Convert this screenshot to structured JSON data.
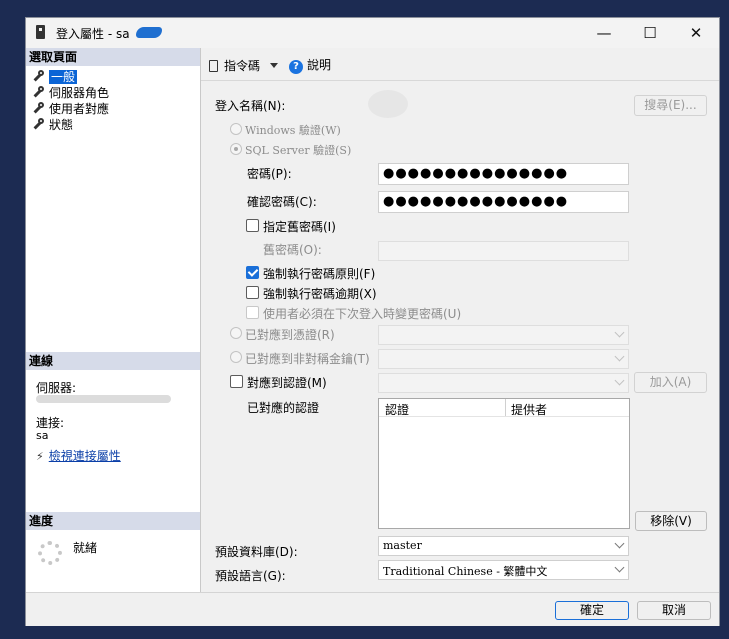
{
  "window": {
    "title": "登入屬性 - sa",
    "minimize": "—",
    "maximize": "☐",
    "close": "✕"
  },
  "left": {
    "select_page_header": "選取頁面",
    "pages": [
      {
        "label": "一般"
      },
      {
        "label": "伺服器角色"
      },
      {
        "label": "使用者對應"
      },
      {
        "label": "狀態"
      }
    ],
    "connection_header": "連線",
    "server_label": "伺服器:",
    "connection_label": "連接:",
    "connection_value": "sa",
    "view_conn_link": "檢視連接屬性",
    "progress_header": "進度",
    "progress_status": "就緒"
  },
  "toolbar": {
    "script_label": "指令碼",
    "help_label": "說明"
  },
  "form": {
    "login_name_label": "登入名稱(N):",
    "search_button": "搜尋(E)...",
    "windows_auth": "Windows 驗證(W)",
    "sql_auth": "SQL Server 驗證(S)",
    "password_label": "密碼(P):",
    "password_value": "●●●●●●●●●●●●●●●",
    "confirm_label": "確認密碼(C):",
    "confirm_value": "●●●●●●●●●●●●●●●",
    "specify_old_label": "指定舊密碼(I)",
    "old_password_label": "舊密碼(O):",
    "enforce_policy_label": "強制執行密碼原則(F)",
    "enforce_expiration_label": "強制執行密碼逾期(X)",
    "must_change_label": "使用者必須在下次登入時變更密碼(U)",
    "map_cert_label": "已對應到憑證(R)",
    "map_asym_label": "已對應到非對稱金鑰(T)",
    "map_cred_label": "對應到認證(M)",
    "add_button": "加入(A)",
    "mapped_creds_label": "已對應的認證",
    "col_credential": "認證",
    "col_provider": "提供者",
    "remove_button": "移除(V)",
    "default_db_label": "預設資料庫(D):",
    "default_db_value": "master",
    "default_lang_label": "預設語言(G):",
    "default_lang_value": "Traditional Chinese - 繁體中文"
  },
  "footer": {
    "ok_button": "確定",
    "cancel_button": "取消"
  }
}
